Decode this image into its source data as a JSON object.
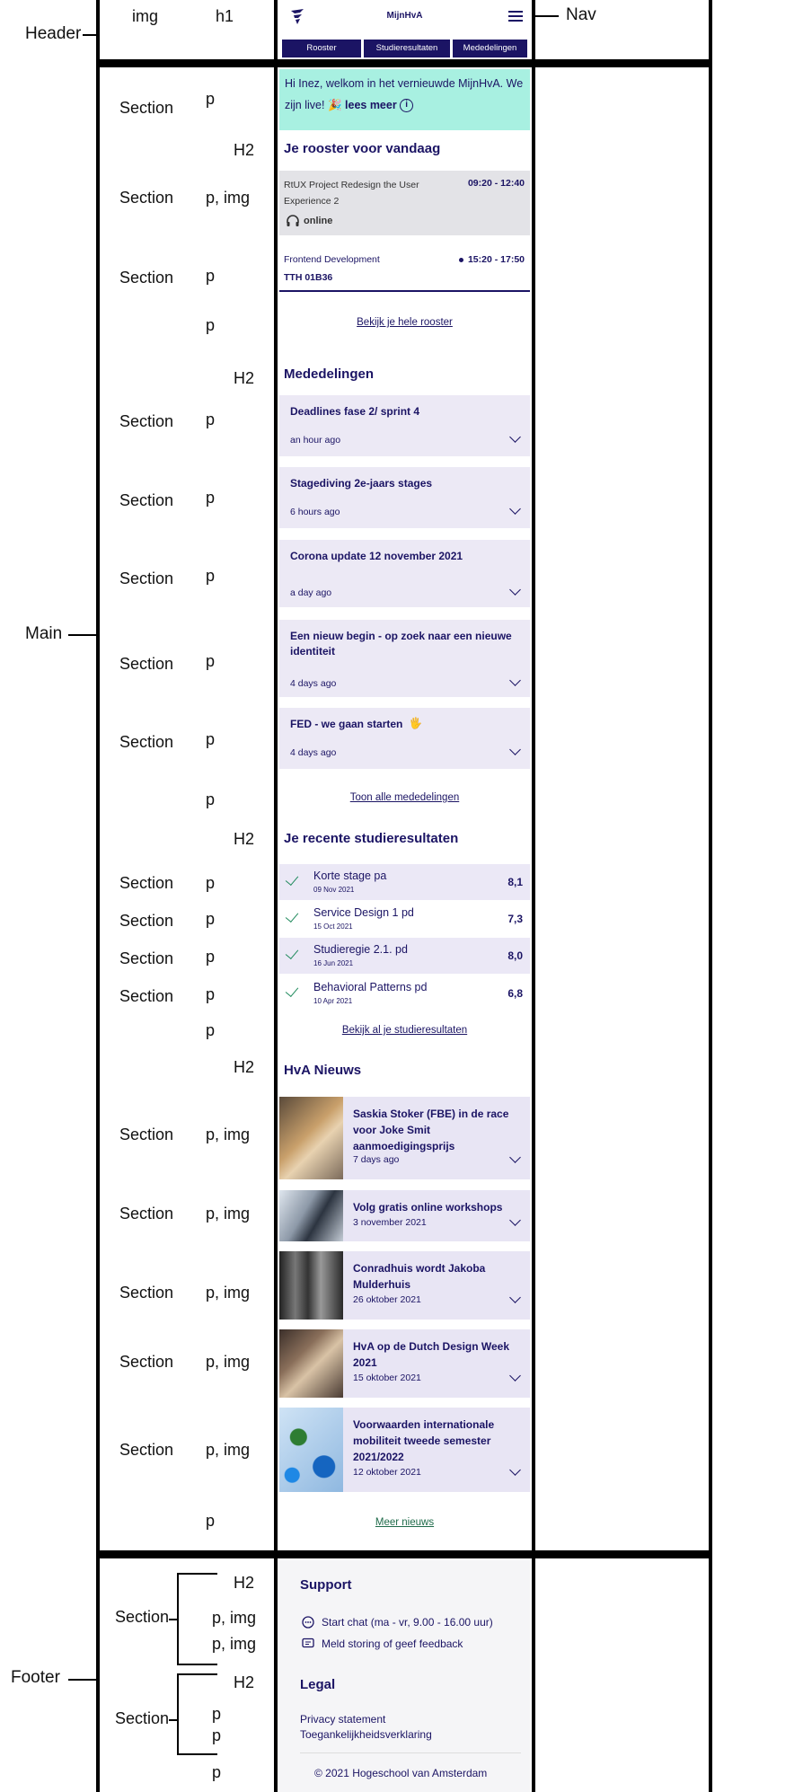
{
  "structure_labels": {
    "header": "Header",
    "nav": "Nav",
    "main": "Main",
    "footer": "Footer",
    "img": "img",
    "h1": "h1",
    "h2": "H2",
    "section": "Section",
    "p": "p",
    "p_img": "p, img"
  },
  "app": {
    "brand": "MijnHvA",
    "tabs": [
      "Rooster",
      "Studieresultaten",
      "Mededelingen"
    ],
    "welcome_text": "Hi Inez, welkom in het vernieuwde MijnHvA. We zijn live!",
    "welcome_emoji": "🎉",
    "welcome_link": "lees meer",
    "info_icon": "info-icon"
  },
  "rooster": {
    "heading": "Je rooster voor vandaag",
    "items": [
      {
        "title": "RtUX Project Redesign the User Experience 2",
        "time": "09:20 - 12:40",
        "location": "online",
        "icon": "headset-icon"
      },
      {
        "title": "Frontend Development",
        "time": "15:20 - 17:50",
        "location": "TTH 01B36"
      }
    ],
    "link": "Bekijk je hele rooster"
  },
  "mededelingen": {
    "heading": "Mededelingen",
    "items": [
      {
        "title": "Deadlines fase 2/ sprint 4",
        "date": "an hour ago"
      },
      {
        "title": "Stagediving 2e-jaars stages",
        "date": "6 hours ago"
      },
      {
        "title": "Corona update 12 november 2021",
        "date": "a day ago"
      },
      {
        "title": "Een nieuw begin - op zoek naar een nieuwe identiteit",
        "date": "4 days ago"
      },
      {
        "title": "FED - we gaan starten",
        "emoji": "🖐",
        "date": "4 days ago"
      }
    ],
    "link": "Toon alle mededelingen"
  },
  "results": {
    "heading": "Je recente studieresultaten",
    "items": [
      {
        "name": "Korte stage pa",
        "date": "09 Nov 2021",
        "grade": "8,1"
      },
      {
        "name": "Service Design 1 pd",
        "date": "15 Oct 2021",
        "grade": "7,3"
      },
      {
        "name": "Studieregie 2.1. pd",
        "date": "16 Jun 2021",
        "grade": "8,0"
      },
      {
        "name": "Behavioral Patterns pd",
        "date": "10 Apr 2021",
        "grade": "6,8"
      }
    ],
    "link": "Bekijk al je studieresultaten"
  },
  "news": {
    "heading": "HvA Nieuws",
    "items": [
      {
        "title": "Saskia Stoker (FBE) in de race voor Joke Smit aanmoedigingsprijs",
        "date": "7 days ago"
      },
      {
        "title": "Volg gratis online workshops",
        "date": "3 november 2021"
      },
      {
        "title": "Conradhuis wordt Jakoba Mulderhuis",
        "date": "26 oktober 2021"
      },
      {
        "title": "HvA op de Dutch Design Week 2021",
        "date": "15 oktober 2021"
      },
      {
        "title": "Voorwaarden internationale mobiliteit tweede semester 2021/2022",
        "date": "12 oktober 2021"
      }
    ],
    "link": "Meer nieuws"
  },
  "footer": {
    "support_heading": "Support",
    "chat": "Start chat (ma - vr, 9.00 - 16.00 uur)",
    "feedback": "Meld storing of geef feedback",
    "legal_heading": "Legal",
    "privacy": "Privacy statement",
    "accessibility": "Toegankelijkheidsverklaring",
    "copyright": "© 2021 Hogeschool van Amsterdam"
  }
}
